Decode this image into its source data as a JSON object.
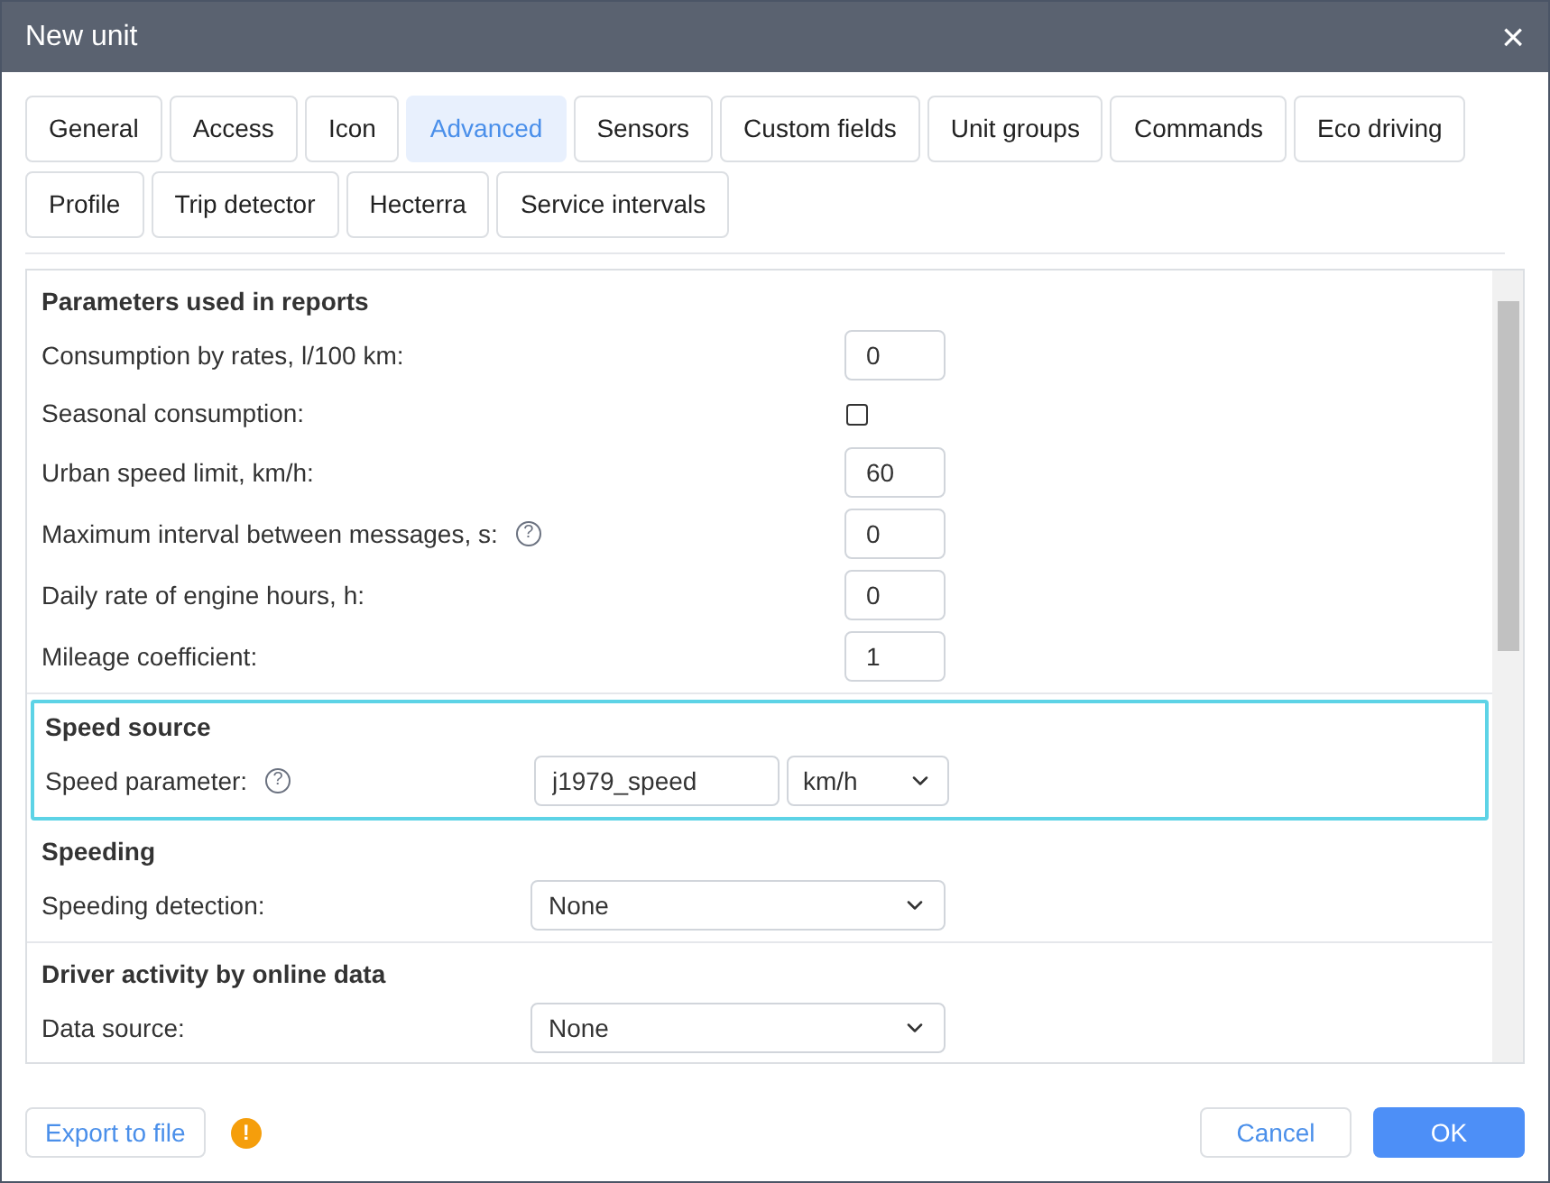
{
  "window": {
    "title": "New unit",
    "close": "×"
  },
  "tabs": [
    {
      "label": "General",
      "selected": false
    },
    {
      "label": "Access",
      "selected": false
    },
    {
      "label": "Icon",
      "selected": false
    },
    {
      "label": "Advanced",
      "selected": true
    },
    {
      "label": "Sensors",
      "selected": false
    },
    {
      "label": "Custom fields",
      "selected": false
    },
    {
      "label": "Unit groups",
      "selected": false
    },
    {
      "label": "Commands",
      "selected": false
    },
    {
      "label": "Eco driving",
      "selected": false
    },
    {
      "label": "Profile",
      "selected": false
    },
    {
      "label": "Trip detector",
      "selected": false
    },
    {
      "label": "Hecterra",
      "selected": false
    },
    {
      "label": "Service intervals",
      "selected": false
    }
  ],
  "sections": [
    {
      "title": "Parameters used in reports",
      "highlighted": false,
      "rows": [
        {
          "kind": "input",
          "label": "Consumption by rates, l/100 km:",
          "value": "0"
        },
        {
          "kind": "checkbox",
          "label": "Seasonal consumption:",
          "checked": false
        },
        {
          "kind": "input",
          "label": "Urban speed limit, km/h:",
          "value": "60"
        },
        {
          "kind": "input",
          "label": "Maximum interval between messages, s:",
          "help": "?",
          "value": "0"
        },
        {
          "kind": "input",
          "label": "Daily rate of engine hours, h:",
          "value": "0"
        },
        {
          "kind": "input",
          "label": "Mileage coefficient:",
          "value": "1"
        }
      ]
    },
    {
      "title": "Speed source",
      "highlighted": true,
      "rows": [
        {
          "kind": "input_select",
          "label": "Speed parameter:",
          "help": "?",
          "value": "j1979_speed",
          "unit": "km/h"
        }
      ]
    },
    {
      "title": "Speeding",
      "highlighted": false,
      "rows": [
        {
          "kind": "select",
          "label": "Speeding detection:",
          "value": "None"
        }
      ]
    },
    {
      "title": "Driver activity by online data",
      "highlighted": false,
      "rows": [
        {
          "kind": "select",
          "label": "Data source:",
          "value": "None"
        }
      ]
    }
  ],
  "footer": {
    "export": "Export to file",
    "warning": "!",
    "cancel": "Cancel",
    "ok": "OK"
  }
}
